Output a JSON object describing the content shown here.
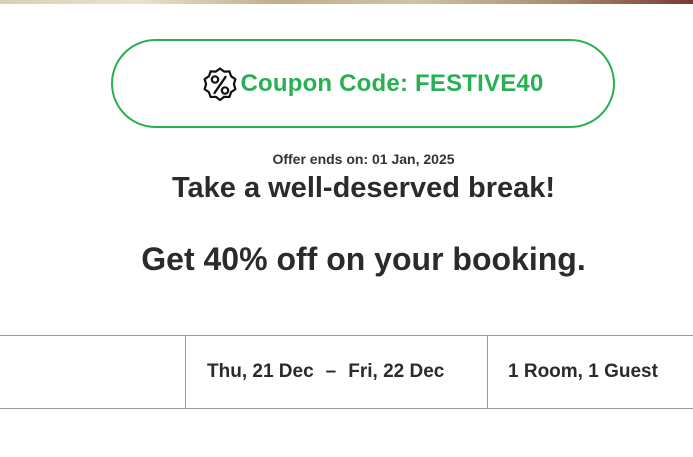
{
  "coupon": {
    "label": "Coupon Code: FESTIVE40",
    "icon": "percent-badge-icon",
    "color": "#27b153"
  },
  "offer": {
    "ends_text": "Offer ends on: 01 Jan, 2025",
    "headline": "Take a well-deserved break!",
    "subheadline": "Get 40% off on your booking."
  },
  "search": {
    "check_in": "Thu, 21 Dec",
    "separator": "–",
    "check_out": "Fri, 22 Dec",
    "occupancy": "1 Room, 1 Guest"
  }
}
